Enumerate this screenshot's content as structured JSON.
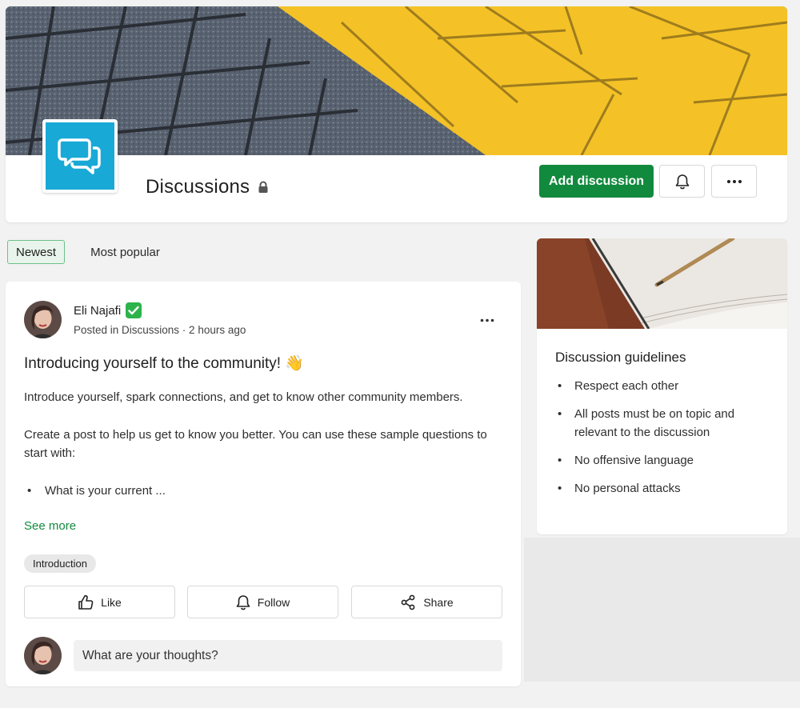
{
  "header": {
    "title": "Discussions",
    "add_label": "Add discussion"
  },
  "tabs": [
    {
      "label": "Newest",
      "active": true
    },
    {
      "label": "Most popular",
      "active": false
    }
  ],
  "post": {
    "author": "Eli Najafi",
    "author_badge": "✅",
    "meta": "Posted in Discussions · 2 hours ago",
    "title": "Introducing yourself to the community! 👋",
    "body_p1": "Introduce yourself, spark connections, and get to know other community members.",
    "body_p2": "Create a post to help us get to know you better. You can use these sample questions to start with:",
    "body_list": [
      "What is your current ..."
    ],
    "see_more": "See more",
    "tag": "Introduction",
    "actions": {
      "like": "Like",
      "follow": "Follow",
      "share": "Share"
    },
    "comment_placeholder": "What are your thoughts?"
  },
  "sidebar": {
    "title": "Discussion guidelines",
    "items": [
      "Respect each other",
      "All posts must be on topic and relevant to the discussion",
      "No offensive language",
      "No personal attacks"
    ]
  },
  "colors": {
    "accent": "#128a3e",
    "logo_bg": "#19a9d6",
    "banner_yellow": "#f4c227"
  },
  "icons": [
    "chat-bubbles-icon",
    "lock-icon",
    "bell-icon",
    "more-horizontal-icon",
    "verified-check-icon",
    "thumbs-up-icon",
    "share-icon"
  ]
}
